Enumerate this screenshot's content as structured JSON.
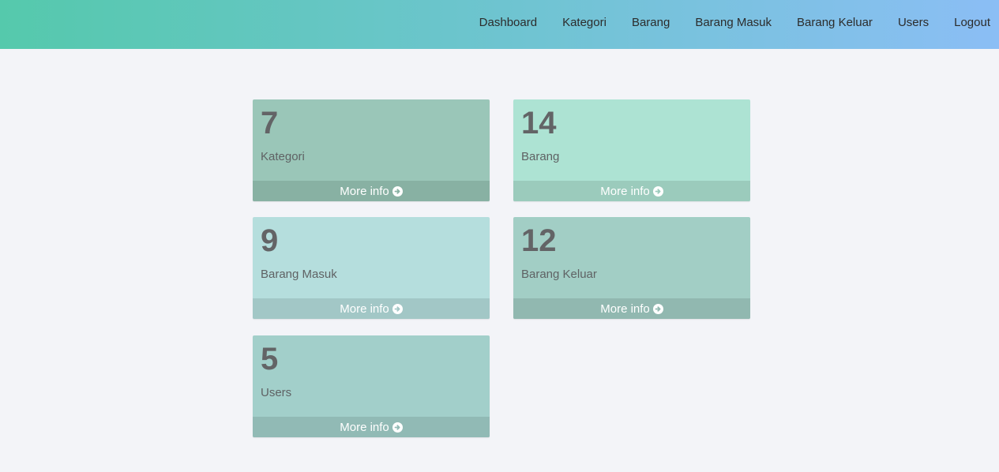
{
  "nav": {
    "items": [
      "Dashboard",
      "Kategori",
      "Barang",
      "Barang Masuk",
      "Barang Keluar",
      "Users",
      "Logout"
    ]
  },
  "cards": [
    {
      "count": "7",
      "label": "Kategori",
      "more": "More info",
      "bg": "#9ac6b8",
      "footer_bg": "#88b1a3"
    },
    {
      "count": "14",
      "label": "Barang",
      "more": "More info",
      "bg": "#ade3d3",
      "footer_bg": "#9bcbbc"
    },
    {
      "count": "9",
      "label": "Barang Masuk",
      "more": "More info",
      "bg": "#b5dedd",
      "footer_bg": "#a2c7c6"
    },
    {
      "count": "12",
      "label": "Barang Keluar",
      "more": "More info",
      "bg": "#a2cec5",
      "footer_bg": "#91b8b0"
    },
    {
      "count": "5",
      "label": "Users",
      "more": "More info",
      "bg": "#a2cfca",
      "footer_bg": "#91bab5"
    }
  ],
  "icons": {
    "more_info": "arrow-circle-right-icon"
  }
}
